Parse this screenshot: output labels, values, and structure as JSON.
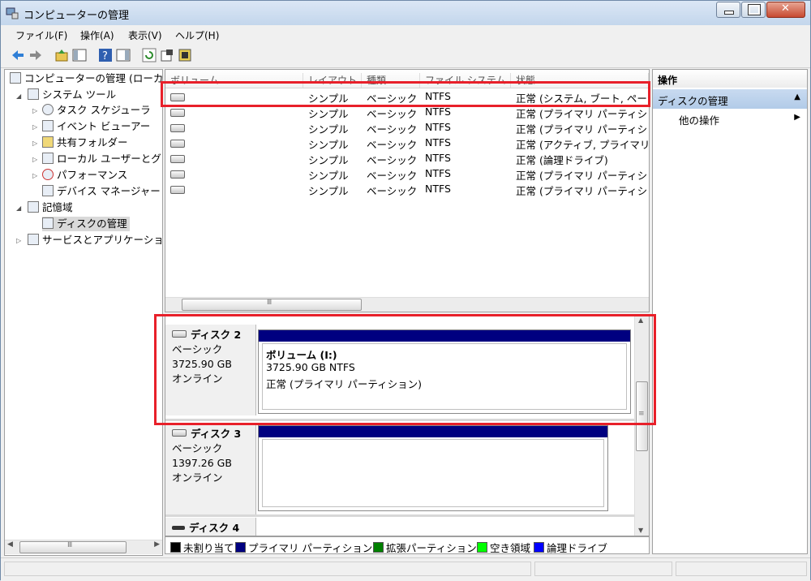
{
  "window": {
    "title": "コンピューターの管理"
  },
  "menu": [
    "ファイル(F)",
    "操作(A)",
    "表示(V)",
    "ヘルプ(H)"
  ],
  "tree": {
    "root": "コンピューターの管理 (ローカ",
    "system_tools": "システム ツール",
    "task_scheduler": "タスク スケジューラ",
    "event_viewer": "イベント ビューアー",
    "shared_folders": "共有フォルダー",
    "local_users": "ローカル ユーザーとグ",
    "performance": "パフォーマンス",
    "device_manager": "デバイス マネージャー",
    "storage": "記憶域",
    "disk_management": "ディスクの管理",
    "services_apps": "サービスとアプリケーショ"
  },
  "volumes": {
    "columns": [
      "ボリューム",
      "レイアウト",
      "種類",
      "ファイル システム",
      "状態"
    ],
    "rows": [
      {
        "volume": "",
        "layout": "シンプル",
        "type": "ベーシック",
        "fs": "NTFS",
        "status": "正常 (システム, ブート, ページ"
      },
      {
        "volume": "",
        "layout": "シンプル",
        "type": "ベーシック",
        "fs": "NTFS",
        "status": "正常 (プライマリ パーティショ"
      },
      {
        "volume": "",
        "layout": "シンプル",
        "type": "ベーシック",
        "fs": "NTFS",
        "status": "正常 (プライマリ パーティショ"
      },
      {
        "volume": "",
        "layout": "シンプル",
        "type": "ベーシック",
        "fs": "NTFS",
        "status": "正常 (アクティブ, プライマリ"
      },
      {
        "volume": "",
        "layout": "シンプル",
        "type": "ベーシック",
        "fs": "NTFS",
        "status": "正常 (論理ドライブ)"
      },
      {
        "volume": "",
        "layout": "シンプル",
        "type": "ベーシック",
        "fs": "NTFS",
        "status": "正常 (プライマリ パーティショ"
      },
      {
        "volume": "",
        "layout": "シンプル",
        "type": "ベーシック",
        "fs": "NTFS",
        "status": "正常 (プライマリ パーティショ"
      }
    ]
  },
  "disks": [
    {
      "name": "ディスク 2",
      "kind": "ベーシック",
      "size": "3725.90 GB",
      "state": "オンライン",
      "partition": {
        "title": "ボリューム (I:)",
        "info": "3725.90 GB NTFS",
        "status": "正常 (プライマリ パーティション)"
      }
    },
    {
      "name": "ディスク 3",
      "kind": "ベーシック",
      "size": "1397.26 GB",
      "state": "オンライン"
    },
    {
      "name": "ディスク 4"
    }
  ],
  "legend": [
    {
      "label": "未割り当て",
      "color": "#000000"
    },
    {
      "label": "プライマリ パーティション",
      "color": "#000080"
    },
    {
      "label": "拡張パーティション",
      "color": "#008000"
    },
    {
      "label": "空き領域",
      "color": "#00ff00"
    },
    {
      "label": "論理ドライブ",
      "color": "#0000ff"
    }
  ],
  "actions": {
    "header": "操作",
    "selected": "ディスクの管理",
    "more": "他の操作"
  },
  "scroll": {
    "h_thumb": "Ⅲ",
    "v_thumb": "≡"
  },
  "colors": {
    "highlight": "#e8202a",
    "partition_bar": "#000080",
    "selection": "#b2cbe8"
  }
}
